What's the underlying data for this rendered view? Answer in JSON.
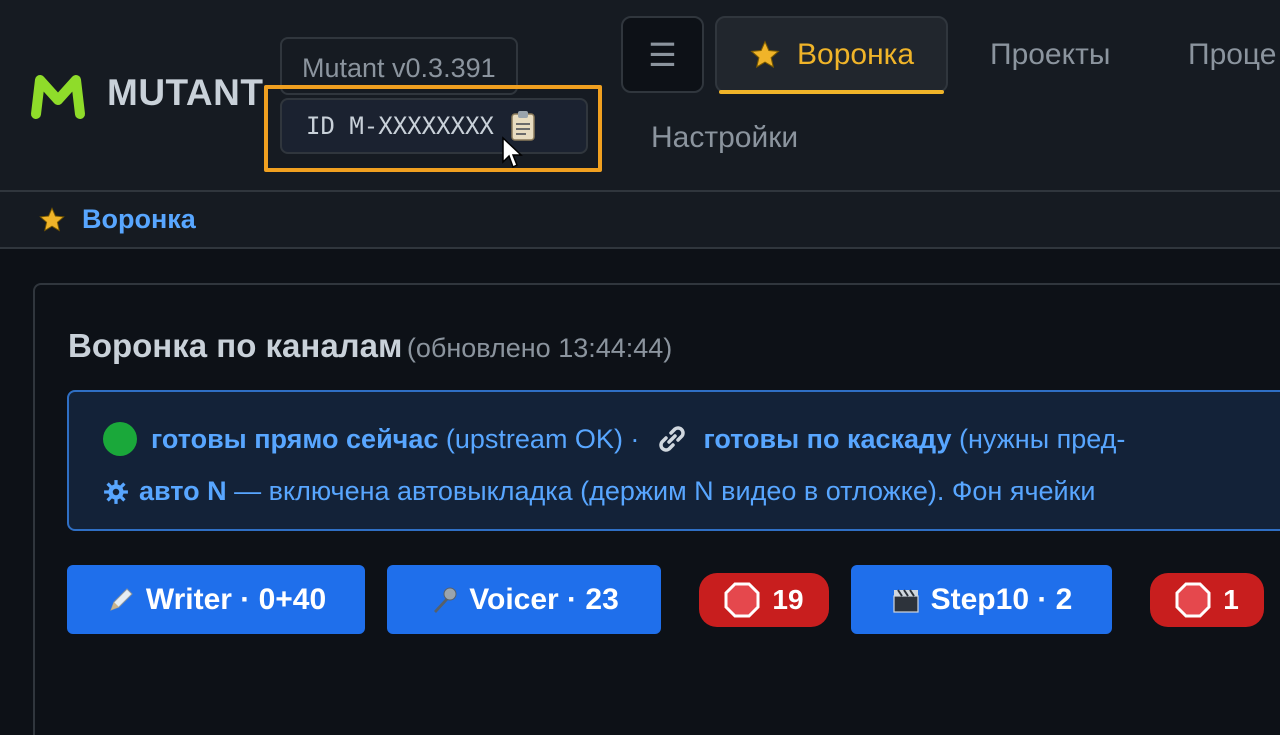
{
  "header": {
    "brand": "MUTANT",
    "version": "Mutant v0.3.391",
    "id_label": "ID M-XXXXXXXX",
    "menu_glyph": "☰",
    "nav": [
      {
        "label": "Воронка",
        "active": true,
        "icon": "star-icon"
      },
      {
        "label": "Проекты"
      },
      {
        "label": "Проце"
      },
      {
        "label": "Настройки"
      }
    ],
    "accent_color": "#f0b429",
    "highlight_color": "#f0a020"
  },
  "breadcrumb": {
    "label": "Воронка",
    "icon": "star-icon"
  },
  "panel": {
    "title": "Воронка по каналам",
    "updated": "(обновлено 13:44:44)"
  },
  "legend": {
    "line1": {
      "ready_now": "готовы прямо сейчас",
      "ready_now_note": " (upstream OK) ·",
      "ready_cascade": "готовы по каскаду",
      "ready_cascade_note": " (нужны пред-"
    },
    "line2": {
      "auto": "авто N",
      "auto_note": " — включена автовыкладка (держим N видео в отложке). Фон ячейки"
    }
  },
  "stages": [
    {
      "label": "Writer · 0+40",
      "icon": "pen-icon"
    },
    {
      "label": "Voicer · 23",
      "icon": "microphone-icon"
    },
    {
      "badge": "19",
      "icon": "stop-sign-icon",
      "color": "#c81e1e"
    },
    {
      "label": "Step10 · 2",
      "icon": "clapperboard-icon"
    },
    {
      "badge": "1",
      "icon": "stop-sign-icon",
      "color": "#c81e1e"
    }
  ]
}
